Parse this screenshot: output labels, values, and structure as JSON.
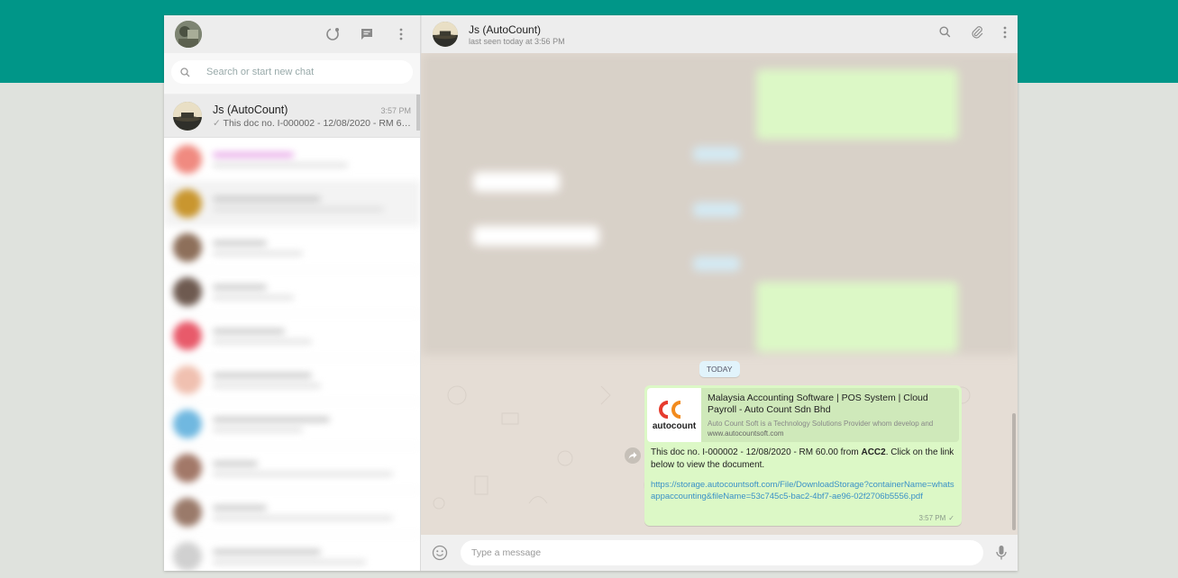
{
  "colors": {
    "accent_band": "#009688",
    "chat_bg": "#e5ddd5",
    "outgoing_bubble": "#dcf8c6",
    "link_color": "#3a91c7"
  },
  "sidebar": {
    "header_icons": [
      "status-icon",
      "new-chat-icon",
      "menu-icon"
    ],
    "search": {
      "placeholder": "Search or start new chat"
    },
    "active_chat": {
      "name": "Js (AutoCount)",
      "time": "3:57 PM",
      "preview": "This doc no. I-000002 - 12/08/2020 - RM 60.0..."
    }
  },
  "chat": {
    "header": {
      "name": "Js (AutoCount)",
      "status": "last seen today at 3:56 PM"
    },
    "date_divider": "TODAY",
    "message": {
      "link_preview": {
        "title": "Malaysia Accounting Software | POS System | Cloud Payroll - Auto Count Sdn Bhd",
        "description": "Auto Count Soft is a Technology Solutions Provider whom develop and",
        "url": "www.autocountsoft.com",
        "logo_text": "autocount"
      },
      "text_before": "This doc no. I-000002 - 12/08/2020 - RM 60.00 from ",
      "text_bold": "ACC2",
      "text_after": ". Click on the link below to view the document.",
      "link": "https://storage.autocountsoft.com/File/DownloadStorage?containerName=whatsappaccounting&fileName=53c745c5-bac2-4bf7-ae96-02f2706b5556.pdf",
      "time": "3:57 PM"
    },
    "composer": {
      "placeholder": "Type a message"
    }
  }
}
